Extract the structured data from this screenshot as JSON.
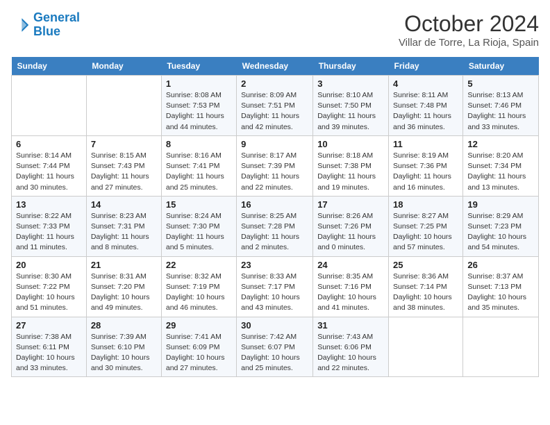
{
  "logo": {
    "line1": "General",
    "line2": "Blue"
  },
  "title": "October 2024",
  "subtitle": "Villar de Torre, La Rioja, Spain",
  "weekdays": [
    "Sunday",
    "Monday",
    "Tuesday",
    "Wednesday",
    "Thursday",
    "Friday",
    "Saturday"
  ],
  "weeks": [
    [
      {
        "day": "",
        "info": ""
      },
      {
        "day": "",
        "info": ""
      },
      {
        "day": "1",
        "info": "Sunrise: 8:08 AM\nSunset: 7:53 PM\nDaylight: 11 hours and 44 minutes."
      },
      {
        "day": "2",
        "info": "Sunrise: 8:09 AM\nSunset: 7:51 PM\nDaylight: 11 hours and 42 minutes."
      },
      {
        "day": "3",
        "info": "Sunrise: 8:10 AM\nSunset: 7:50 PM\nDaylight: 11 hours and 39 minutes."
      },
      {
        "day": "4",
        "info": "Sunrise: 8:11 AM\nSunset: 7:48 PM\nDaylight: 11 hours and 36 minutes."
      },
      {
        "day": "5",
        "info": "Sunrise: 8:13 AM\nSunset: 7:46 PM\nDaylight: 11 hours and 33 minutes."
      }
    ],
    [
      {
        "day": "6",
        "info": "Sunrise: 8:14 AM\nSunset: 7:44 PM\nDaylight: 11 hours and 30 minutes."
      },
      {
        "day": "7",
        "info": "Sunrise: 8:15 AM\nSunset: 7:43 PM\nDaylight: 11 hours and 27 minutes."
      },
      {
        "day": "8",
        "info": "Sunrise: 8:16 AM\nSunset: 7:41 PM\nDaylight: 11 hours and 25 minutes."
      },
      {
        "day": "9",
        "info": "Sunrise: 8:17 AM\nSunset: 7:39 PM\nDaylight: 11 hours and 22 minutes."
      },
      {
        "day": "10",
        "info": "Sunrise: 8:18 AM\nSunset: 7:38 PM\nDaylight: 11 hours and 19 minutes."
      },
      {
        "day": "11",
        "info": "Sunrise: 8:19 AM\nSunset: 7:36 PM\nDaylight: 11 hours and 16 minutes."
      },
      {
        "day": "12",
        "info": "Sunrise: 8:20 AM\nSunset: 7:34 PM\nDaylight: 11 hours and 13 minutes."
      }
    ],
    [
      {
        "day": "13",
        "info": "Sunrise: 8:22 AM\nSunset: 7:33 PM\nDaylight: 11 hours and 11 minutes."
      },
      {
        "day": "14",
        "info": "Sunrise: 8:23 AM\nSunset: 7:31 PM\nDaylight: 11 hours and 8 minutes."
      },
      {
        "day": "15",
        "info": "Sunrise: 8:24 AM\nSunset: 7:30 PM\nDaylight: 11 hours and 5 minutes."
      },
      {
        "day": "16",
        "info": "Sunrise: 8:25 AM\nSunset: 7:28 PM\nDaylight: 11 hours and 2 minutes."
      },
      {
        "day": "17",
        "info": "Sunrise: 8:26 AM\nSunset: 7:26 PM\nDaylight: 11 hours and 0 minutes."
      },
      {
        "day": "18",
        "info": "Sunrise: 8:27 AM\nSunset: 7:25 PM\nDaylight: 10 hours and 57 minutes."
      },
      {
        "day": "19",
        "info": "Sunrise: 8:29 AM\nSunset: 7:23 PM\nDaylight: 10 hours and 54 minutes."
      }
    ],
    [
      {
        "day": "20",
        "info": "Sunrise: 8:30 AM\nSunset: 7:22 PM\nDaylight: 10 hours and 51 minutes."
      },
      {
        "day": "21",
        "info": "Sunrise: 8:31 AM\nSunset: 7:20 PM\nDaylight: 10 hours and 49 minutes."
      },
      {
        "day": "22",
        "info": "Sunrise: 8:32 AM\nSunset: 7:19 PM\nDaylight: 10 hours and 46 minutes."
      },
      {
        "day": "23",
        "info": "Sunrise: 8:33 AM\nSunset: 7:17 PM\nDaylight: 10 hours and 43 minutes."
      },
      {
        "day": "24",
        "info": "Sunrise: 8:35 AM\nSunset: 7:16 PM\nDaylight: 10 hours and 41 minutes."
      },
      {
        "day": "25",
        "info": "Sunrise: 8:36 AM\nSunset: 7:14 PM\nDaylight: 10 hours and 38 minutes."
      },
      {
        "day": "26",
        "info": "Sunrise: 8:37 AM\nSunset: 7:13 PM\nDaylight: 10 hours and 35 minutes."
      }
    ],
    [
      {
        "day": "27",
        "info": "Sunrise: 7:38 AM\nSunset: 6:11 PM\nDaylight: 10 hours and 33 minutes."
      },
      {
        "day": "28",
        "info": "Sunrise: 7:39 AM\nSunset: 6:10 PM\nDaylight: 10 hours and 30 minutes."
      },
      {
        "day": "29",
        "info": "Sunrise: 7:41 AM\nSunset: 6:09 PM\nDaylight: 10 hours and 27 minutes."
      },
      {
        "day": "30",
        "info": "Sunrise: 7:42 AM\nSunset: 6:07 PM\nDaylight: 10 hours and 25 minutes."
      },
      {
        "day": "31",
        "info": "Sunrise: 7:43 AM\nSunset: 6:06 PM\nDaylight: 10 hours and 22 minutes."
      },
      {
        "day": "",
        "info": ""
      },
      {
        "day": "",
        "info": ""
      }
    ]
  ]
}
